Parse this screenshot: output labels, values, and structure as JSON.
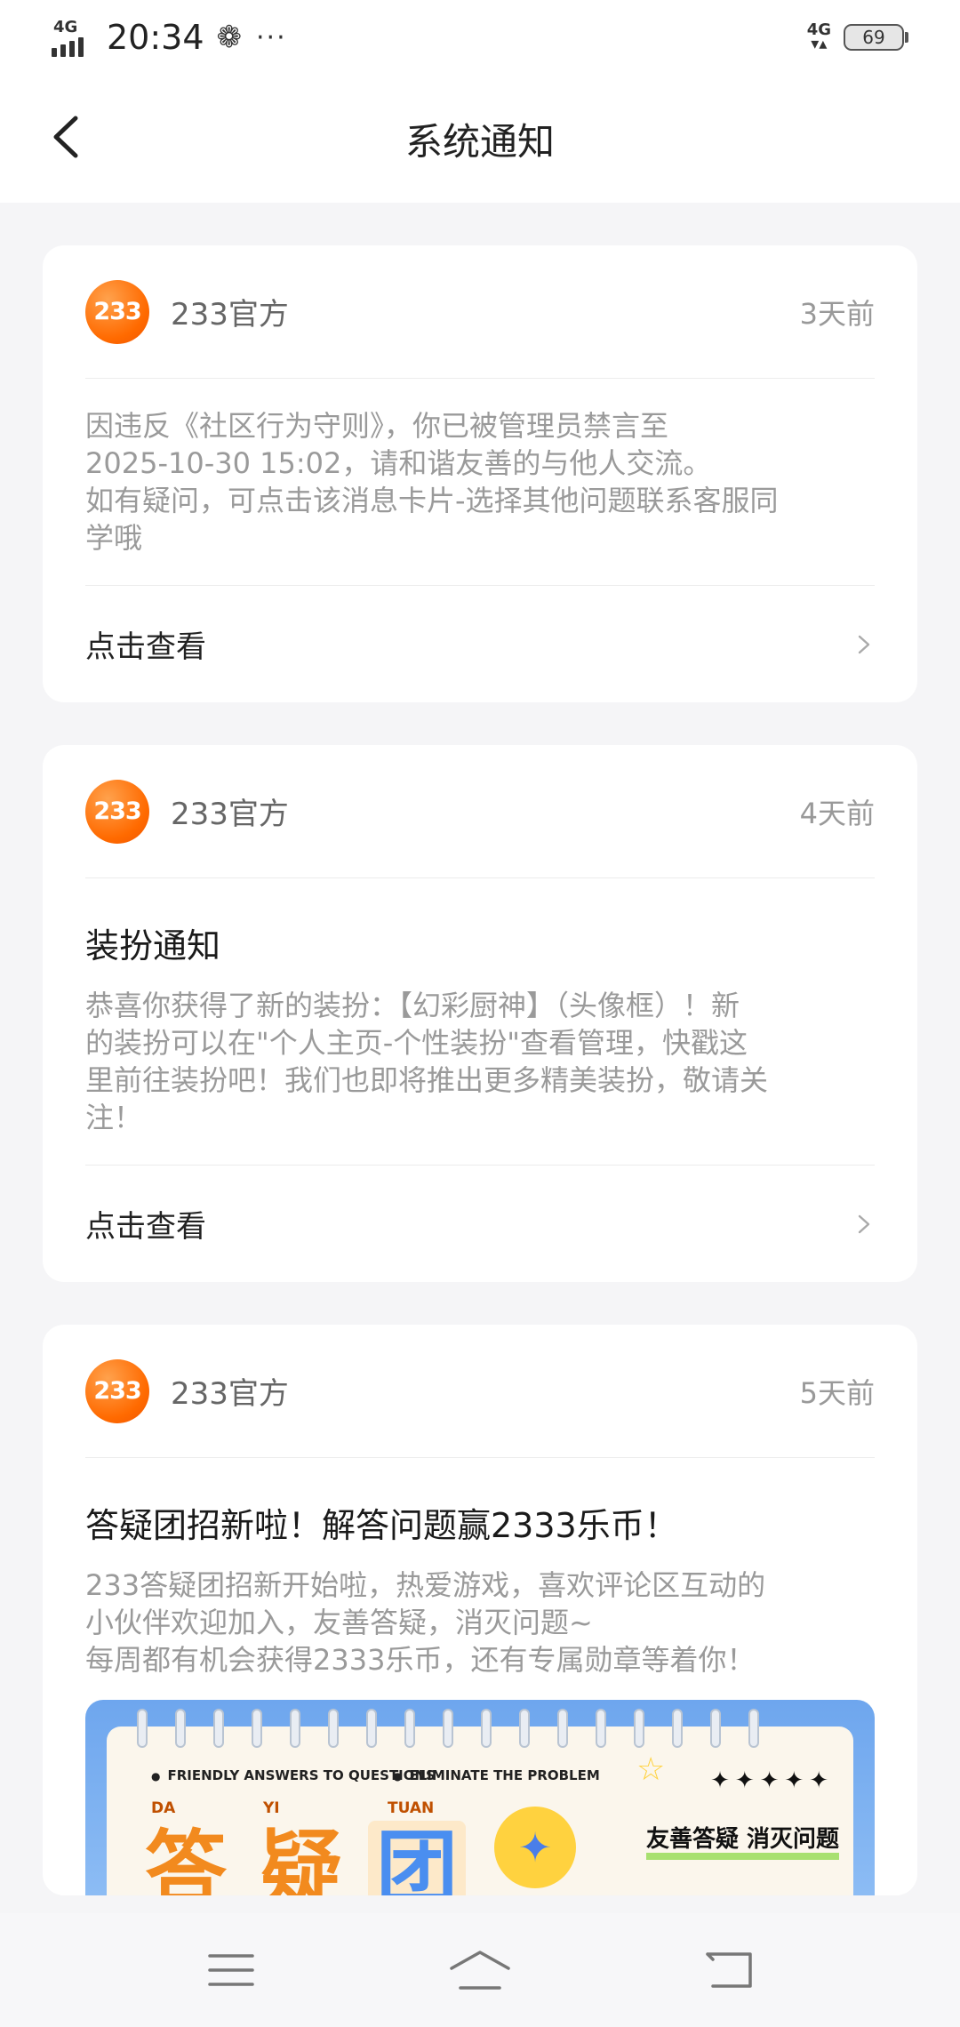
{
  "status_bar": {
    "network": "4G",
    "time": "20:34",
    "fan_glyph": "❁",
    "more": "···",
    "network_right": "4G",
    "battery": "69"
  },
  "header": {
    "title": "系统通知"
  },
  "notifications": [
    {
      "avatar_text": "233",
      "sender": "233官方",
      "time": "3天前",
      "title": "",
      "body": "因违反《社区行为守则》，你已被管理员禁言至\n2025-10-30 15:02，请和谐友善的与他人交流。\n如有疑问，可点击该消息卡片-选择其他问题联系客服同\n学哦",
      "action": "点击查看"
    },
    {
      "avatar_text": "233",
      "sender": "233官方",
      "time": "4天前",
      "title": "装扮通知",
      "body": "恭喜你获得了新的装扮：【幻彩厨神】（头像框）！新\n的装扮可以在\"个人主页-个性装扮\"查看管理，快戳这\n里前往装扮吧！我们也即将推出更多精美装扮，敬请关\n注！",
      "action": "点击查看"
    },
    {
      "avatar_text": "233",
      "sender": "233官方",
      "time": "5天前",
      "title": "答疑团招新啦！解答问题赢2333乐币！",
      "body": "233答疑团招新开始啦，热爱游戏，喜欢评论区互动的\n小伙伴欢迎加入，友善答疑，消灭问题~\n每周都有机会获得2333乐币，还有专属勋章等着你！",
      "banner": {
        "tag_left": "FRIENDLY ANSWERS TO QUESTIONS",
        "tag_right": "ELIMINATE THE PROBLEM",
        "pinyin": [
          "DA",
          "YI",
          "TUAN"
        ],
        "chars": [
          "答",
          "疑",
          "团"
        ],
        "stars": "✦✦✦✦✦",
        "slogan": "友善答疑 消灭问题"
      }
    }
  ],
  "colors": {
    "avatar": "#ff6a00",
    "page_bg": "#f5f5f7",
    "banner_blue": "#6ea6ee",
    "char_orange": "#f28a1e",
    "char_blue": "#4a8ef0"
  }
}
